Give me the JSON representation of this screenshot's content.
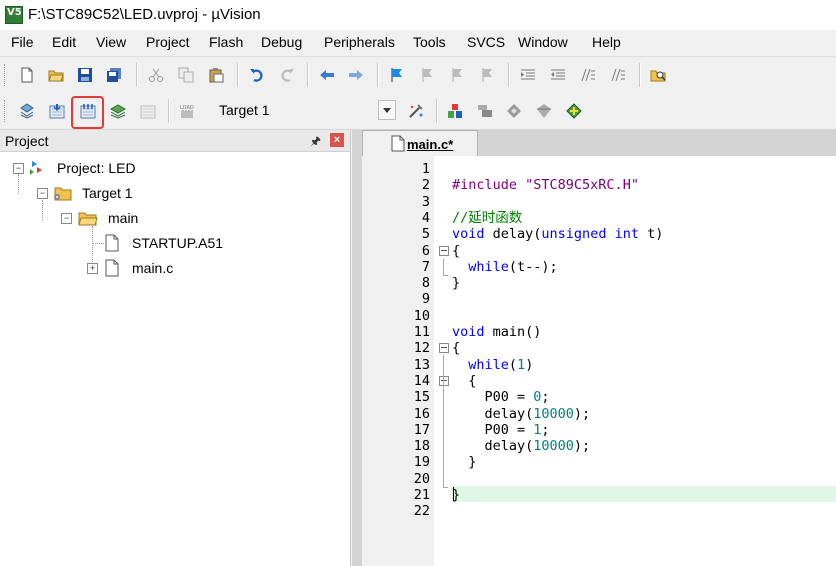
{
  "window": {
    "title": "F:\\STC89C52\\LED.uvproj - µVision",
    "app_icon": "uvision-icon"
  },
  "menubar": {
    "items": [
      "File",
      "Edit",
      "View",
      "Project",
      "Flash",
      "Debug",
      "Peripherals",
      "Tools",
      "SVCS",
      "Window",
      "Help"
    ]
  },
  "toolbar1": {
    "icons": [
      "new-file-icon",
      "open-folder-icon",
      "save-icon",
      "save-all-icon",
      "cut-icon",
      "copy-icon",
      "paste-icon",
      "undo-icon",
      "redo-icon",
      "nav-back-icon",
      "nav-forward-icon",
      "bookmark-icon",
      "prev-bookmark-icon",
      "next-bookmark-icon",
      "clear-bookmarks-icon",
      "indent-icon",
      "unindent-icon",
      "comment-icon",
      "uncomment-icon",
      "find-in-files-icon"
    ]
  },
  "toolbar2": {
    "icons": [
      "translate-icon",
      "build-icon",
      "rebuild-icon",
      "batch-build-icon",
      "stop-build-icon",
      "download-icon",
      "target-options-icon",
      "manage-components-icon",
      "select-pack-icon",
      "run-environment-icon",
      "manage-project-items-icon"
    ],
    "target_value": "Target 1",
    "highlighted": "rebuild-icon"
  },
  "project_panel": {
    "title": "Project",
    "tree": {
      "root": "Project: LED",
      "target": "Target 1",
      "group": "main",
      "files": [
        "STARTUP.A51",
        "main.c"
      ]
    }
  },
  "editor": {
    "tab_label": "main.c*",
    "lines": [
      {
        "n": "1",
        "code": ""
      },
      {
        "n": "2",
        "code": "#include \"STC89C5xRC.H\""
      },
      {
        "n": "3",
        "code": ""
      },
      {
        "n": "4",
        "code": "//延时函数"
      },
      {
        "n": "5",
        "code": "void delay(unsigned int t)"
      },
      {
        "n": "6",
        "code": "{"
      },
      {
        "n": "7",
        "code": "  while(t--);"
      },
      {
        "n": "8",
        "code": "}"
      },
      {
        "n": "9",
        "code": ""
      },
      {
        "n": "10",
        "code": ""
      },
      {
        "n": "11",
        "code": "void main()"
      },
      {
        "n": "12",
        "code": "{"
      },
      {
        "n": "13",
        "code": "  while(1)"
      },
      {
        "n": "14",
        "code": "  {"
      },
      {
        "n": "15",
        "code": "    P00 = 0;"
      },
      {
        "n": "16",
        "code": "    delay(10000);"
      },
      {
        "n": "17",
        "code": "    P00 = 1;"
      },
      {
        "n": "18",
        "code": "    delay(10000);"
      },
      {
        "n": "19",
        "code": "  }"
      },
      {
        "n": "20",
        "code": ""
      },
      {
        "n": "21",
        "code": "}"
      },
      {
        "n": "22",
        "code": ""
      }
    ]
  },
  "colors": {
    "keyword": "#0000ff",
    "string": "#800080",
    "comment": "#008000",
    "number": "#008080",
    "highlight_box": "#e53935",
    "current_line": "#e0f7e6"
  }
}
